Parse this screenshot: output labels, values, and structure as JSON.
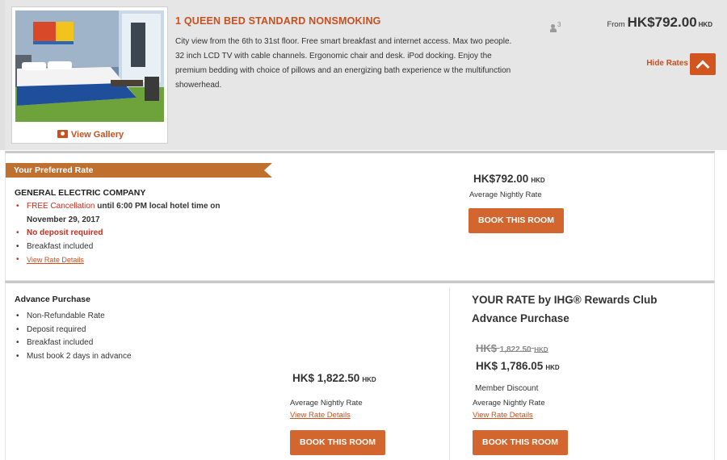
{
  "room": {
    "title": "1 QUEEN BED STANDARD NONSMOKING",
    "description": "City view from the 6th to 31st floor. Free smart breakfast and internet access. Max two people. 32 inch LCD TV with cable channels. Ergonomic chair and desk. iPod docking. Enjoy the premium bedding with choice of pillows and an energizing bath experience w the multifunction showerhead.",
    "max_occupancy": "3",
    "gallery_label": "View Gallery",
    "from_label": "From",
    "from_price": "HK$792.00",
    "from_currency": "HKD",
    "hide_rates_label": "Hide Rates"
  },
  "preferred_rate": {
    "ribbon": "Your Preferred Rate",
    "company": "GENERAL ELECTRIC COMPANY",
    "cancel_free": "FREE Cancellation",
    "cancel_rest_line1": " until 6:00 PM local hotel time on",
    "cancel_rest_line2": "November 29, 2017",
    "no_deposit": "No deposit required",
    "breakfast": "Breakfast included",
    "details_link": "View Rate Details",
    "price": "HK$792.00",
    "currency": "HKD",
    "avg_label": "Average Nightly Rate",
    "book_label": "BOOK THIS ROOM"
  },
  "advance_purchase": {
    "title": "Advance Purchase",
    "benefits": [
      "Non-Refundable Rate",
      "Deposit required",
      "Breakfast included",
      "Must book 2 days in advance"
    ],
    "price": "HK$ 1,822.50",
    "currency": "HKD",
    "avg_label": "Average Nightly Rate",
    "details_link": "View Rate Details",
    "book_label": "BOOK THIS ROOM"
  },
  "ihg_rewards": {
    "title": "YOUR RATE by IHG® Rewards Club Advance Purchase",
    "strike_prefix": "HK$",
    "strike_amount": "1,822.50",
    "strike_currency": "HKD",
    "price": "HK$ 1,786.05",
    "currency": "HKD",
    "member_discount": "Member Discount",
    "avg_label": "Average Nightly Rate",
    "details_link": "View Rate Details",
    "book_label": "BOOK THIS ROOM"
  },
  "colors": {
    "accent": "#c8501f",
    "button": "#d2662e",
    "ribbon": "#c0702e",
    "alert_red": "#c62d1f"
  }
}
